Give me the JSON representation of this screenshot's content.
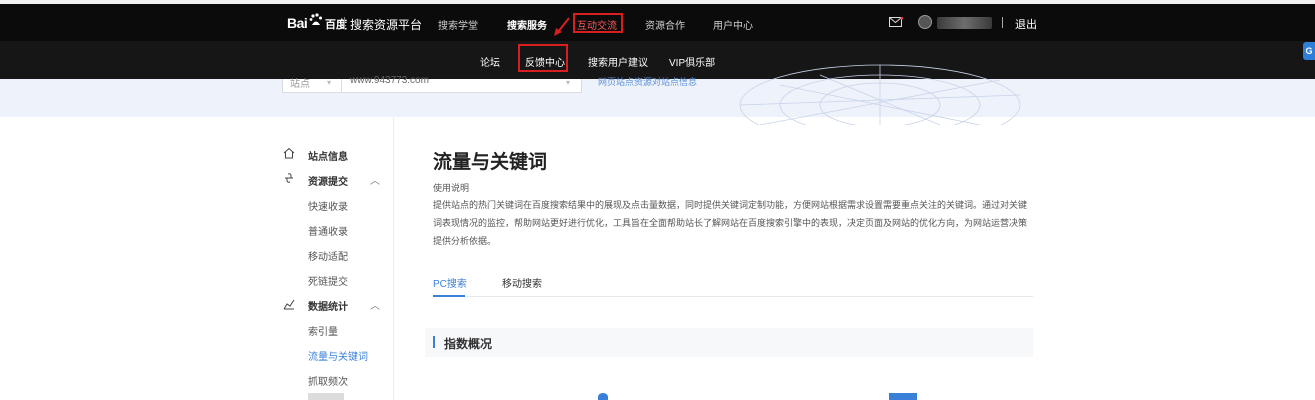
{
  "header": {
    "logo_bai": "Bai",
    "logo_du": "百度",
    "platform_title": "搜索资源平台",
    "nav": [
      {
        "label": "搜索学堂"
      },
      {
        "label": "搜索服务"
      },
      {
        "label": "互动交流"
      },
      {
        "label": "资源合作"
      },
      {
        "label": "用户中心"
      }
    ],
    "logout": "退出"
  },
  "subnav": {
    "items": [
      {
        "label": "论坛"
      },
      {
        "label": "反馈中心"
      },
      {
        "label": "搜索用户建议"
      },
      {
        "label": "VIP俱乐部"
      }
    ]
  },
  "banner": {
    "site_select": "站点",
    "site_url": "www.943773.com",
    "link_text": "网页站点资源对站点信息"
  },
  "side_tab": "G",
  "sidebar": {
    "groups": [
      {
        "label": "站点信息",
        "icon": "home-icon"
      },
      {
        "label": "资源提交",
        "icon": "link-icon",
        "items": [
          "快速收录",
          "普通收录",
          "移动适配",
          "死链提交"
        ]
      },
      {
        "label": "数据统计",
        "icon": "chart-icon",
        "items": [
          "索引量",
          "流量与关键词",
          "抓取频次"
        ]
      }
    ],
    "active_item": "流量与关键词"
  },
  "main": {
    "title": "流量与关键词",
    "usage_label": "使用说明",
    "usage_text": "提供站点的热门关键词在百度搜索结果中的展现及点击量数据，同时提供关键词定制功能，方便网站根据需求设置需要重点关注的关键词。通过对关键词表现情况的监控，帮助网站更好进行优化，工具旨在全面帮助站长了解网站在百度搜索引擎中的表现，决定页面及网站的优化方向，为网站运营决策提供分析依据。",
    "tabs": [
      {
        "label": "PC搜索"
      },
      {
        "label": "移动搜索"
      }
    ],
    "section_title": "指数概况"
  },
  "colors": {
    "accent": "#3a7fd8",
    "highlight_box": "#d81e1e",
    "nav_bg": "#0b0b0b"
  }
}
